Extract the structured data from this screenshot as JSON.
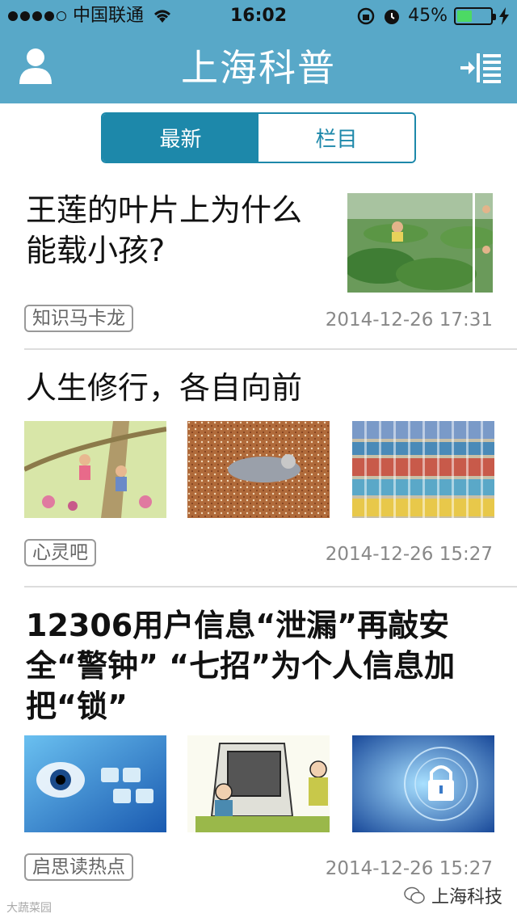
{
  "status_bar": {
    "carrier": "中国联通",
    "time": "16:02",
    "battery_percent": "45%",
    "battery_level": 0.45
  },
  "nav": {
    "title": "上海科普",
    "left_icon": "user-icon",
    "right_icon": "menu-icon"
  },
  "segment": {
    "tabs": [
      {
        "label": "最新",
        "active": true
      },
      {
        "label": "栏目",
        "active": false
      }
    ]
  },
  "articles": [
    {
      "title": "王莲的叶片上为什么能载小孩?",
      "title_line1": "王莲的叶片上为什么",
      "title_line2": "能载小孩?",
      "tag": "知识马卡龙",
      "date": "2014-12-26 17:31"
    },
    {
      "title": "人生修行，各自向前",
      "tag": "心灵吧",
      "date": "2014-12-26 15:27"
    },
    {
      "title": "12306用户信息“泄漏”再敲安全“警钟” “七招”为个人信息加把“锁”",
      "title_line1": "12306用户信息“泄漏”再敲安",
      "title_line2": "全“警钟”  “七招”为个人信息加",
      "title_line3": "把“锁”",
      "tag": "启思读热点",
      "date": "2014-12-26 15:27"
    }
  ],
  "footer": {
    "watermark_left": "大蔬菜园",
    "account_name": "上海科技"
  },
  "colors": {
    "header": "#58a8c8",
    "accent": "#1d88aa"
  }
}
